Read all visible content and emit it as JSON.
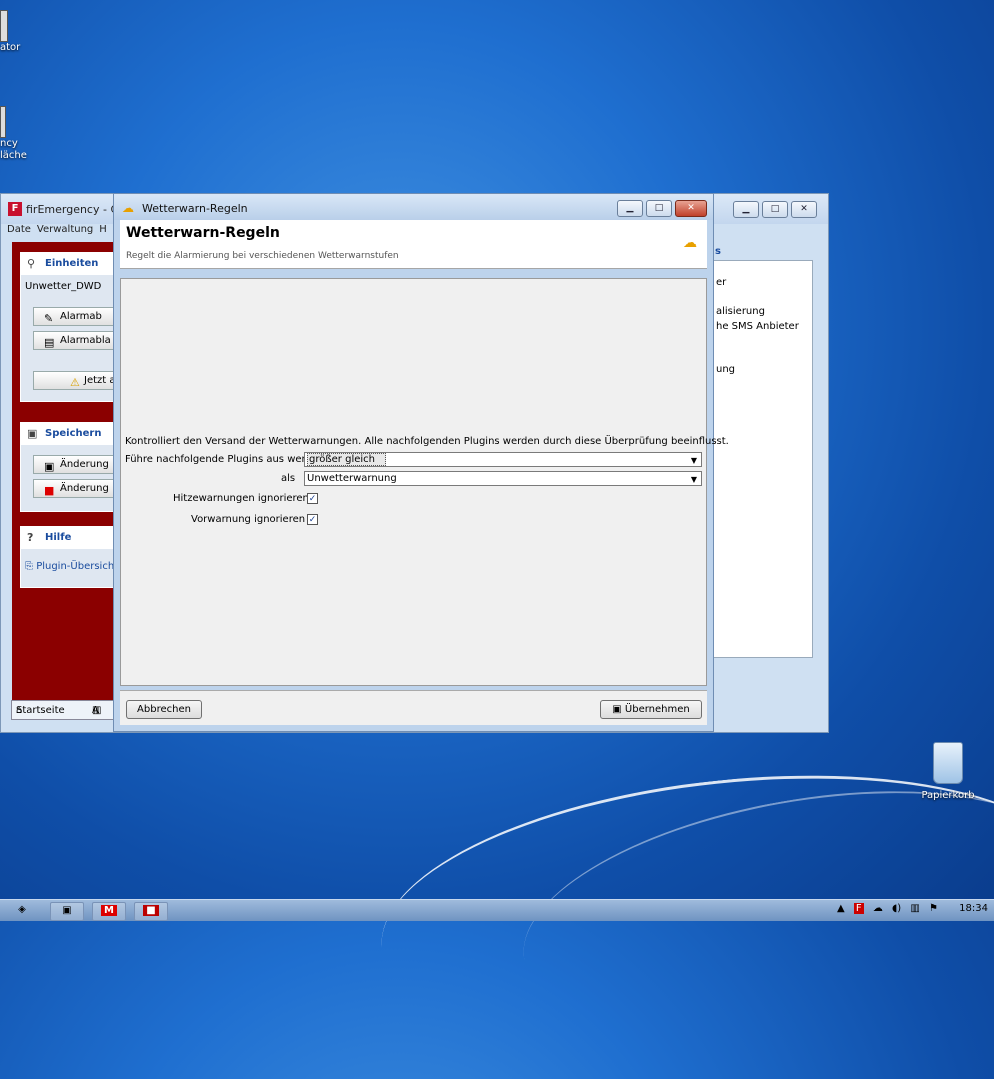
{
  "desktop": {
    "icons": [
      {
        "label": "ator"
      },
      {
        "label": "ncy\nläche"
      },
      {
        "label": "Papierkorb"
      }
    ]
  },
  "bg_window": {
    "title": "firEmergency - Cli",
    "menu": [
      "Date",
      "Verwaltung",
      "H"
    ],
    "sections": {
      "einheiten": {
        "title": "Einheiten",
        "field": "Unwetter_DWD",
        "btn1": "Alarmab",
        "btn2": "Alarmabla",
        "btn3": "Jetzt a"
      },
      "speichern": {
        "title": "Speichern",
        "btn1": "Änderung",
        "btn2": "Änderung"
      },
      "hilfe": {
        "title": "Hilfe",
        "link": "Plugin-Übersich"
      }
    },
    "right_caption": "s",
    "right_items": [
      "er",
      "alisierung",
      "he SMS Anbieter",
      "ung"
    ],
    "tabs": [
      "Startseite",
      "A"
    ]
  },
  "dialog": {
    "title": "Wetterwarn-Regeln",
    "heading": "Wetterwarn-Regeln",
    "subtitle": "Regelt die Alarmierung bei verschiedenen Wetterwarnstufen",
    "description": "Kontrolliert den Versand der Wetterwarnungen. Alle nachfolgenden Plugins werden durch diese Überprüfung beeinflusst.",
    "condition_label": "Führe nachfolgende Plugins aus wenn",
    "condition_value": "größer gleich",
    "level_label": "als",
    "level_value": "Unwetterwarnung",
    "heat_label": "Hitzewarnungen ignorieren",
    "heat_checked": true,
    "pre_label": "Vorwarnung ignorieren",
    "pre_checked": true,
    "cancel": "Abbrechen",
    "apply": "Übernehmen"
  },
  "taskbar": {
    "clock": "18:34",
    "apps": [
      "start",
      "explorer",
      "M",
      "F"
    ]
  },
  "colors": {
    "accent": "#1a4c9e",
    "sidebar": "#8b0000"
  }
}
